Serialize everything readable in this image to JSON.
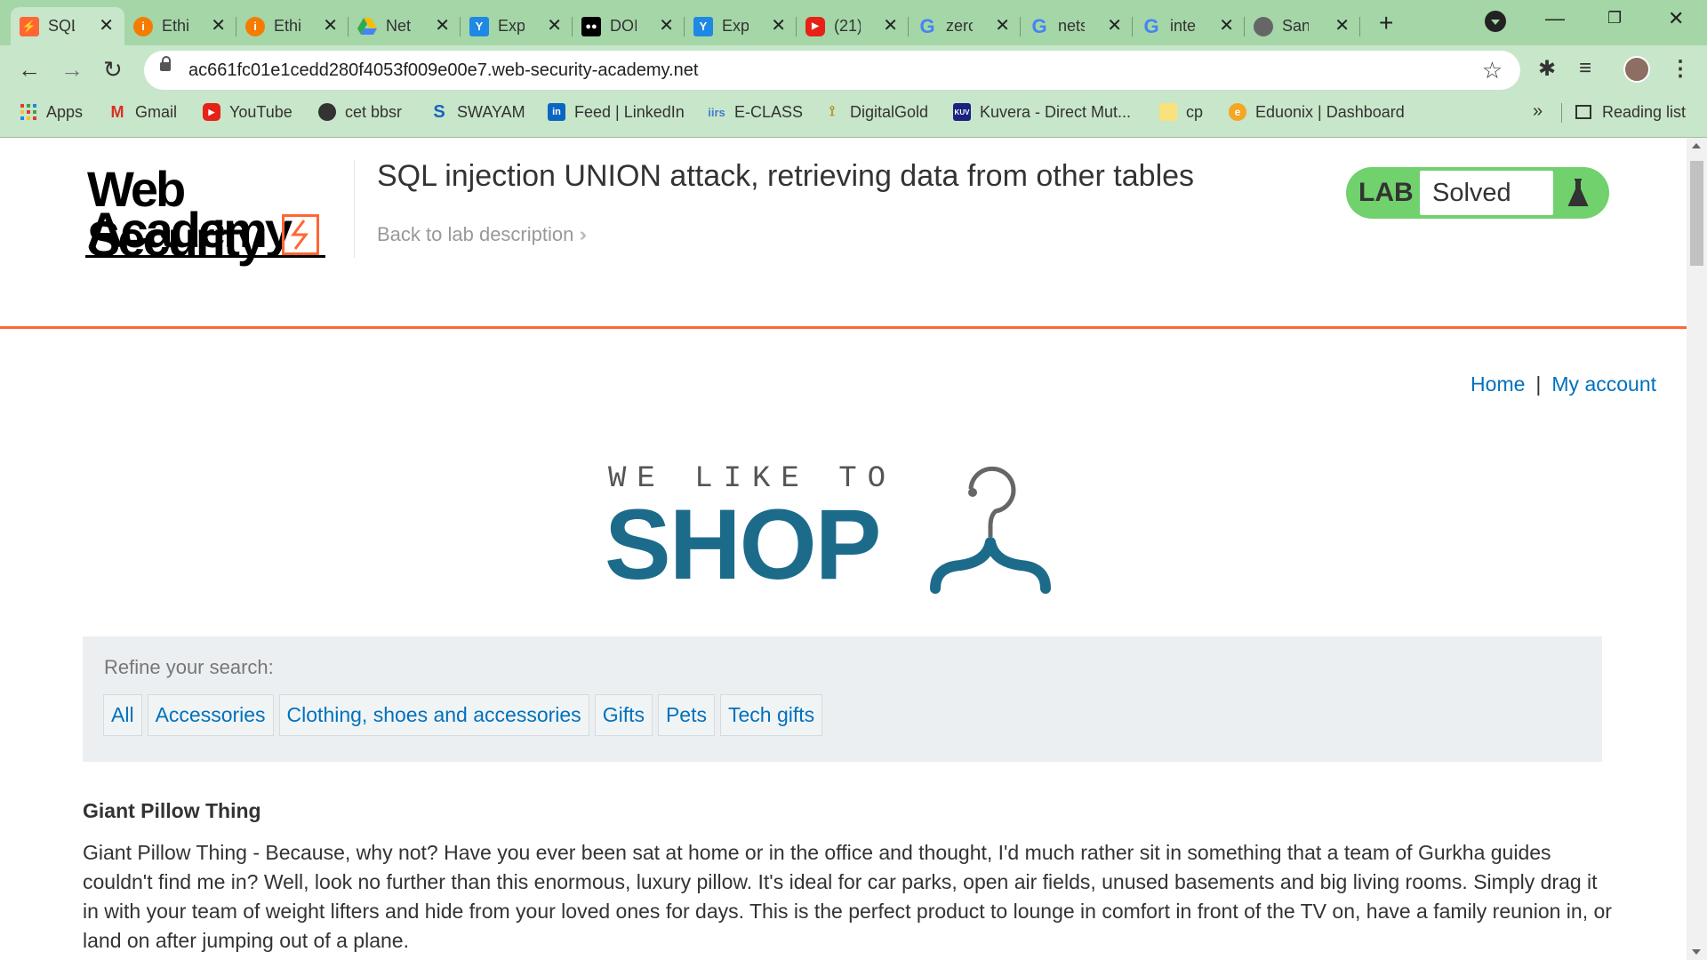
{
  "browser": {
    "tabs": [
      {
        "title": "SQL",
        "favicon": "portswigger-icon",
        "active": true
      },
      {
        "title": "Ethi",
        "favicon": "info-icon"
      },
      {
        "title": "Ethi",
        "favicon": "info-icon"
      },
      {
        "title": "Net",
        "favicon": "google-drive-icon"
      },
      {
        "title": "Exp",
        "favicon": "y-icon"
      },
      {
        "title": "DOI",
        "favicon": "medium-icon"
      },
      {
        "title": "Exp",
        "favicon": "y-icon"
      },
      {
        "title": "(21)",
        "favicon": "youtube-icon"
      },
      {
        "title": "zerc",
        "favicon": "google-icon"
      },
      {
        "title": "nets",
        "favicon": "google-icon"
      },
      {
        "title": "inte",
        "favicon": "google-icon"
      },
      {
        "title": "San",
        "favicon": "globe-icon"
      }
    ],
    "url": "ac661fc01e1cedd280f4053f009e00e7.web-security-academy.net",
    "bookmarks": [
      {
        "label": "Apps",
        "icon": "apps-grid-icon"
      },
      {
        "label": "Gmail",
        "icon": "gmail-icon"
      },
      {
        "label": "YouTube",
        "icon": "youtube-icon"
      },
      {
        "label": "cet bbsr",
        "icon": "globe-icon"
      },
      {
        "label": "SWAYAM",
        "icon": "swayam-icon"
      },
      {
        "label": "Feed | LinkedIn",
        "icon": "linkedin-icon"
      },
      {
        "label": "E-CLASS",
        "icon": "iirs-icon"
      },
      {
        "label": "DigitalGold",
        "icon": "digitalgold-icon"
      },
      {
        "label": "Kuvera - Direct Mut...",
        "icon": "kuvera-icon"
      },
      {
        "label": "cp",
        "icon": "folder-icon"
      },
      {
        "label": "Eduonix | Dashboard",
        "icon": "eduonix-icon"
      }
    ],
    "more_bookmarks": "»",
    "reading_list": "Reading list"
  },
  "header": {
    "logo_line1": "Web Security",
    "logo_line2": "Academy",
    "lab_title": "SQL injection UNION attack, retrieving data from other tables",
    "back_link": "Back to lab description",
    "lab_badge": "LAB",
    "lab_status": "Solved"
  },
  "nav": {
    "home": "Home",
    "separator": "|",
    "my_account": "My account"
  },
  "shop_logo": {
    "top": "WE LIKE TO",
    "main": "SHOP"
  },
  "refine": {
    "label": "Refine your search:",
    "filters": [
      "All",
      "Accessories",
      "Clothing, shoes and accessories",
      "Gifts",
      "Pets",
      "Tech gifts"
    ]
  },
  "product": {
    "name": "Giant Pillow Thing",
    "description": "Giant Pillow Thing - Because, why not? Have you ever been sat at home or in the office and thought, I'd much rather sit in something that a team of Gurkha guides couldn't find me in? Well, look no further than this enormous, luxury pillow. It's ideal for car parks, open air fields, unused basements and big living rooms. Simply drag it in with your team of weight lifters and hide from your loved ones for days. This is the perfect product to lounge in comfort in front of the TV on, have a family reunion in, or land on after jumping out of a plane."
  },
  "colors": {
    "accent": "#ff6633",
    "link": "#0071bc",
    "shop_blue": "#1d6b8b",
    "lab_green": "#70d16d"
  }
}
